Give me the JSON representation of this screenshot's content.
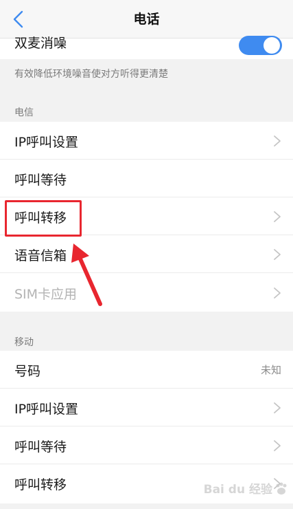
{
  "header": {
    "title": "电话"
  },
  "noise_reduction": {
    "label": "双麦消噪",
    "enabled": true,
    "description": "有效降低环境噪音使对方听得更清楚"
  },
  "sections": [
    {
      "title": "电信",
      "items": [
        {
          "label": "IP呼叫设置",
          "has_chevron": true
        },
        {
          "label": "呼叫等待",
          "has_chevron": false
        },
        {
          "label": "呼叫转移",
          "has_chevron": true,
          "highlighted": true
        },
        {
          "label": "语音信箱",
          "has_chevron": true
        },
        {
          "label": "SIM卡应用",
          "has_chevron": true,
          "disabled": true
        }
      ]
    },
    {
      "title": "移动",
      "items": [
        {
          "label": "号码",
          "value": "未知"
        },
        {
          "label": "IP呼叫设置",
          "has_chevron": true
        },
        {
          "label": "呼叫等待",
          "has_chevron": true
        },
        {
          "label": "呼叫转移",
          "has_chevron": true
        }
      ]
    }
  ],
  "watermark": {
    "text": "Bai du 经验"
  },
  "colors": {
    "toggle_on": "#3f8bf0",
    "highlight": "#e8262f",
    "back_arrow": "#3f8bf0"
  },
  "icons": {
    "back": "chevron-left-icon",
    "row_arrow": "chevron-right-icon"
  }
}
